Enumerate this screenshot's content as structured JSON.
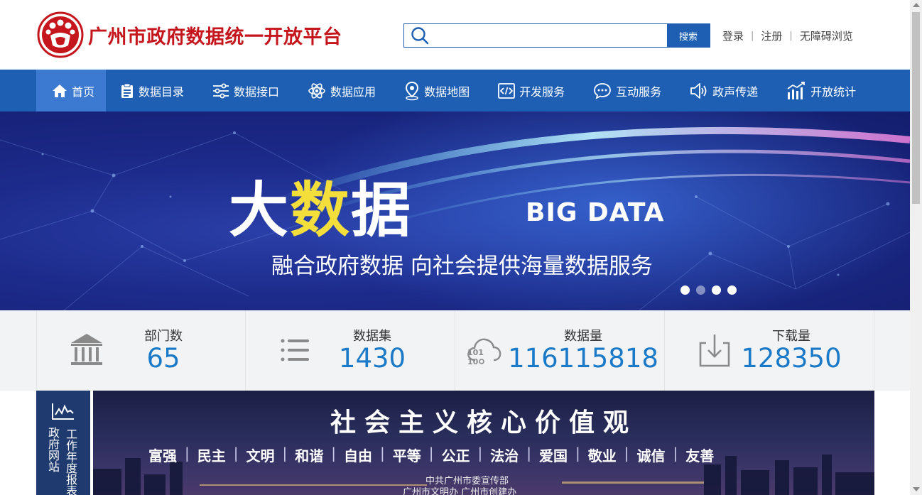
{
  "header": {
    "site_title": "广州市政府数据统一开放平台",
    "search": {
      "placeholder": "",
      "button_label": "搜索"
    },
    "links": {
      "login": "登录",
      "register": "注册",
      "accessibility": "无障碍浏览",
      "separator": "|"
    }
  },
  "nav": {
    "items": [
      {
        "label": "首页",
        "icon": "home-icon"
      },
      {
        "label": "数据目录",
        "icon": "clipboard-icon"
      },
      {
        "label": "数据接口",
        "icon": "sliders-icon"
      },
      {
        "label": "数据应用",
        "icon": "atom-icon"
      },
      {
        "label": "数据地图",
        "icon": "map-pin-icon"
      },
      {
        "label": "开发服务",
        "icon": "code-icon"
      },
      {
        "label": "互动服务",
        "icon": "chat-icon"
      },
      {
        "label": "政声传递",
        "icon": "speaker-icon"
      },
      {
        "label": "开放统计",
        "icon": "bar-chart-icon"
      }
    ],
    "active": "首页"
  },
  "banner": {
    "headline_part1": "大",
    "headline_part2": "数",
    "headline_part3": "据",
    "headline_en": "BIG DATA",
    "subtitle": "融合政府数据 向社会提供海量数据服务",
    "slides_count": 4,
    "active_slide": 2
  },
  "stats": [
    {
      "label": "部门数",
      "value": "65",
      "icon": "building-icon"
    },
    {
      "label": "数据集",
      "value": "1430",
      "icon": "list-icon"
    },
    {
      "label": "数据量",
      "value": "116115818",
      "icon": "cloud-data-icon"
    },
    {
      "label": "下载量",
      "value": "128350",
      "icon": "download-icon"
    }
  ],
  "report": {
    "col1": "政府网站",
    "col2": "工作年度报表",
    "icon": "activity-chart-icon"
  },
  "values_banner": {
    "title": "社会主义核心价值观",
    "values": [
      "富强",
      "民主",
      "文明",
      "和谐",
      "自由",
      "平等",
      "公正",
      "法治",
      "爱国",
      "敬业",
      "诚信",
      "友善"
    ],
    "org_line1": "中共广州市委宣传部",
    "org_line2": "广州市文明办  广州市创建办"
  },
  "colors": {
    "brand_red": "#c4161c",
    "nav_blue": "#1e5fb3",
    "stat_blue": "#1a7ac8"
  }
}
